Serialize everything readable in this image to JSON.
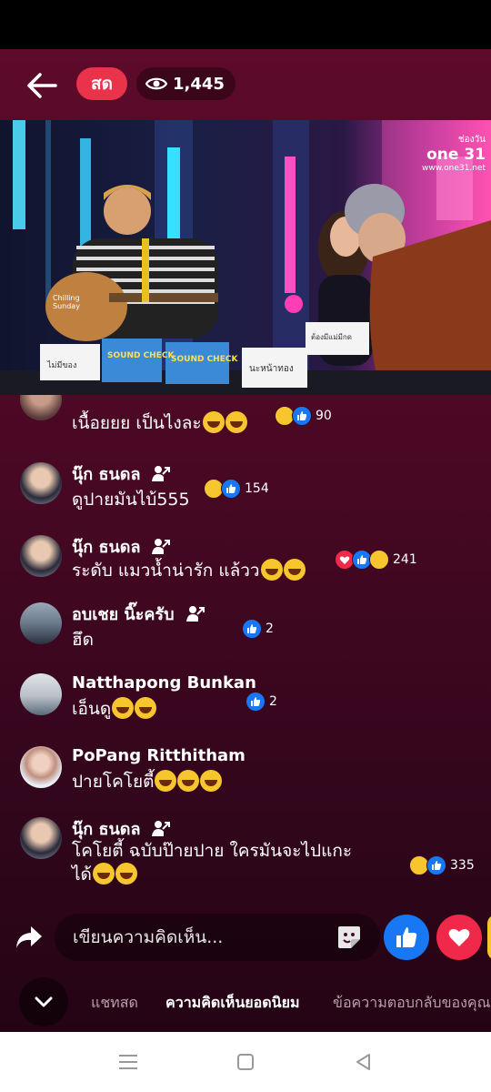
{
  "header": {
    "live_label": "สด",
    "viewer_count": "1,445",
    "icons": [
      "back-arrow-icon",
      "eye-icon"
    ]
  },
  "video": {
    "channel_top": "ช่องวัน",
    "channel_logo": "one 31",
    "channel_url": "www.one31.net",
    "desk_signs": [
      "ไม่มีของ",
      "SOUND CHECK",
      "SOUND CHECK",
      "นะหน้าทอง",
      "ต้องมีแม่มีกด"
    ],
    "guitar_sticker": "Chilling Sunday"
  },
  "comments": [
    {
      "name": "",
      "text": "เนื้อยยย เป็นไงละ",
      "emojis": 2,
      "reactions": [
        "haha",
        "like"
      ],
      "count": "90"
    },
    {
      "name": "นุ๊ก ธนดล",
      "text": "ดูปายมันไบ้555",
      "emojis": 0,
      "reactions": [
        "haha",
        "like"
      ],
      "count": "154"
    },
    {
      "name": "นุ๊ก ธนดล",
      "text": "ระดับ แมวน้ำน่ารัก แล้วว",
      "emojis": 2,
      "reactions": [
        "love",
        "like",
        "haha"
      ],
      "count": "241"
    },
    {
      "name": "อบเชย นิ๊ะครับ",
      "text": "ฮึด",
      "emojis": 0,
      "reactions": [
        "like"
      ],
      "count": "2"
    },
    {
      "name": "Natthapong Bunkan",
      "text": "เอ็นดู",
      "emojis": 2,
      "reactions": [
        "like"
      ],
      "count": "2"
    },
    {
      "name": "PoPang Ritthitham",
      "text": "ปายโคโยตี้",
      "emojis": 3,
      "reactions": [],
      "count": ""
    },
    {
      "name": "นุ๊ก ธนดล",
      "text": "โคโยตี้ ฉบับป๊ายปาย ใครมันจะไปแกะ",
      "text2": "ได้",
      "emojis": 2,
      "reactions": [
        "haha",
        "like"
      ],
      "count": "335"
    }
  ],
  "composer": {
    "placeholder": "เขียนความคิดเห็น...",
    "icons": [
      "share-icon",
      "sticker-icon",
      "like-icon",
      "heart-icon"
    ]
  },
  "tabs": {
    "live_chat": "แชทสด",
    "top_comments": "ความคิดเห็นยอดนิยม",
    "replies": "ข้อความตอบกลับของคุณ"
  },
  "colors": {
    "bg_top": "#5e0a2a",
    "bg_bottom": "#240414",
    "live_badge": "#e8334a",
    "like": "#1877f2",
    "love": "#f02849",
    "haha": "#f7c62e"
  }
}
